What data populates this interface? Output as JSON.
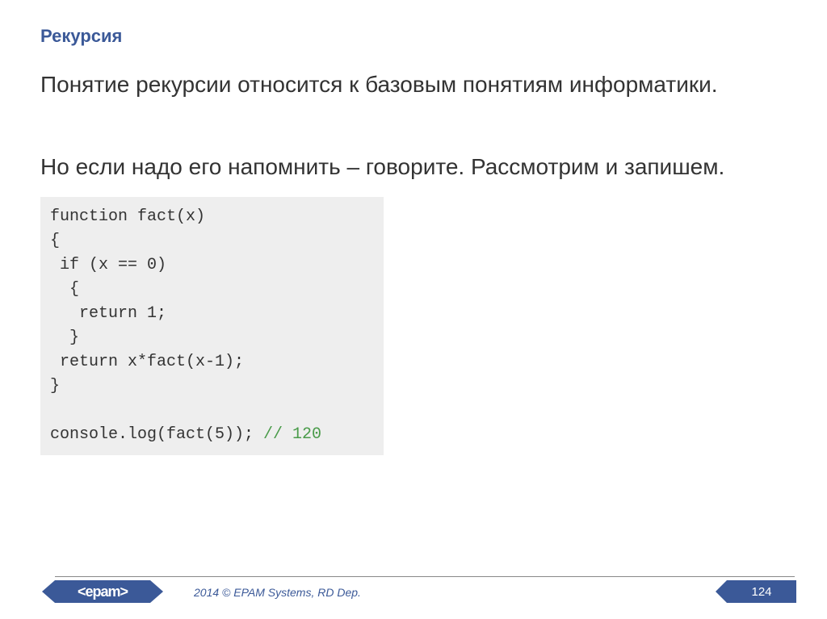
{
  "title": "Рекурсия",
  "paragraph1": "Понятие рекурсии относится к базовым понятиям информатики.",
  "paragraph2": "Но если надо его напомнить – говорите. Рассмотрим и запишем.",
  "code": {
    "line1": "function fact(x)",
    "line2": "{",
    "line3": " if (x == 0)",
    "line4": "  {",
    "line5": "   return 1;",
    "line6": "  }",
    "line7": " return x*fact(x-1);",
    "line8": "}",
    "line9": "",
    "line10_part1": "console.log(fact(5)); ",
    "line10_comment": "// 120"
  },
  "footer": {
    "logo": "<epam>",
    "copyright": "2014 © EPAM Systems, RD Dep.",
    "page_number": "124"
  }
}
